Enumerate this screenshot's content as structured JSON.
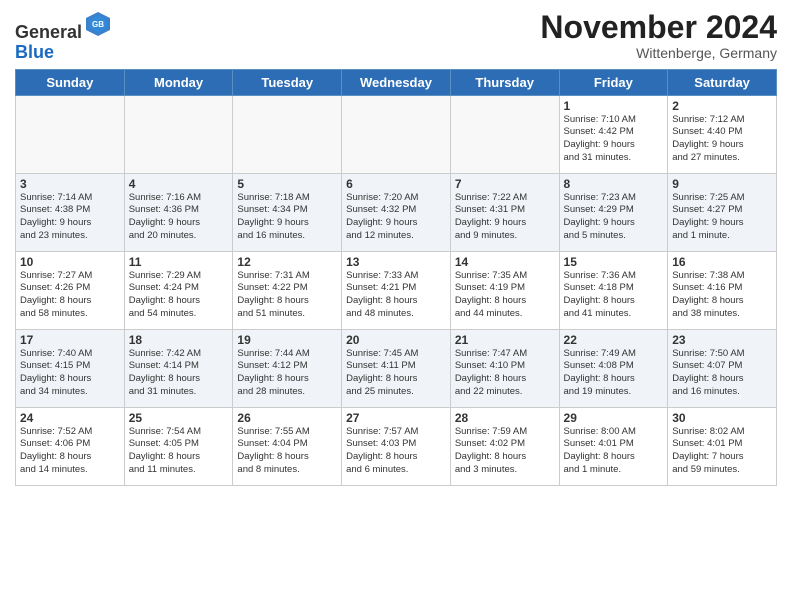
{
  "header": {
    "logo_line1": "General",
    "logo_line2": "Blue",
    "month": "November 2024",
    "location": "Wittenberge, Germany"
  },
  "weekdays": [
    "Sunday",
    "Monday",
    "Tuesday",
    "Wednesday",
    "Thursday",
    "Friday",
    "Saturday"
  ],
  "weeks": [
    [
      {
        "day": "",
        "info": ""
      },
      {
        "day": "",
        "info": ""
      },
      {
        "day": "",
        "info": ""
      },
      {
        "day": "",
        "info": ""
      },
      {
        "day": "",
        "info": ""
      },
      {
        "day": "1",
        "info": "Sunrise: 7:10 AM\nSunset: 4:42 PM\nDaylight: 9 hours\nand 31 minutes."
      },
      {
        "day": "2",
        "info": "Sunrise: 7:12 AM\nSunset: 4:40 PM\nDaylight: 9 hours\nand 27 minutes."
      }
    ],
    [
      {
        "day": "3",
        "info": "Sunrise: 7:14 AM\nSunset: 4:38 PM\nDaylight: 9 hours\nand 23 minutes."
      },
      {
        "day": "4",
        "info": "Sunrise: 7:16 AM\nSunset: 4:36 PM\nDaylight: 9 hours\nand 20 minutes."
      },
      {
        "day": "5",
        "info": "Sunrise: 7:18 AM\nSunset: 4:34 PM\nDaylight: 9 hours\nand 16 minutes."
      },
      {
        "day": "6",
        "info": "Sunrise: 7:20 AM\nSunset: 4:32 PM\nDaylight: 9 hours\nand 12 minutes."
      },
      {
        "day": "7",
        "info": "Sunrise: 7:22 AM\nSunset: 4:31 PM\nDaylight: 9 hours\nand 9 minutes."
      },
      {
        "day": "8",
        "info": "Sunrise: 7:23 AM\nSunset: 4:29 PM\nDaylight: 9 hours\nand 5 minutes."
      },
      {
        "day": "9",
        "info": "Sunrise: 7:25 AM\nSunset: 4:27 PM\nDaylight: 9 hours\nand 1 minute."
      }
    ],
    [
      {
        "day": "10",
        "info": "Sunrise: 7:27 AM\nSunset: 4:26 PM\nDaylight: 8 hours\nand 58 minutes."
      },
      {
        "day": "11",
        "info": "Sunrise: 7:29 AM\nSunset: 4:24 PM\nDaylight: 8 hours\nand 54 minutes."
      },
      {
        "day": "12",
        "info": "Sunrise: 7:31 AM\nSunset: 4:22 PM\nDaylight: 8 hours\nand 51 minutes."
      },
      {
        "day": "13",
        "info": "Sunrise: 7:33 AM\nSunset: 4:21 PM\nDaylight: 8 hours\nand 48 minutes."
      },
      {
        "day": "14",
        "info": "Sunrise: 7:35 AM\nSunset: 4:19 PM\nDaylight: 8 hours\nand 44 minutes."
      },
      {
        "day": "15",
        "info": "Sunrise: 7:36 AM\nSunset: 4:18 PM\nDaylight: 8 hours\nand 41 minutes."
      },
      {
        "day": "16",
        "info": "Sunrise: 7:38 AM\nSunset: 4:16 PM\nDaylight: 8 hours\nand 38 minutes."
      }
    ],
    [
      {
        "day": "17",
        "info": "Sunrise: 7:40 AM\nSunset: 4:15 PM\nDaylight: 8 hours\nand 34 minutes."
      },
      {
        "day": "18",
        "info": "Sunrise: 7:42 AM\nSunset: 4:14 PM\nDaylight: 8 hours\nand 31 minutes."
      },
      {
        "day": "19",
        "info": "Sunrise: 7:44 AM\nSunset: 4:12 PM\nDaylight: 8 hours\nand 28 minutes."
      },
      {
        "day": "20",
        "info": "Sunrise: 7:45 AM\nSunset: 4:11 PM\nDaylight: 8 hours\nand 25 minutes."
      },
      {
        "day": "21",
        "info": "Sunrise: 7:47 AM\nSunset: 4:10 PM\nDaylight: 8 hours\nand 22 minutes."
      },
      {
        "day": "22",
        "info": "Sunrise: 7:49 AM\nSunset: 4:08 PM\nDaylight: 8 hours\nand 19 minutes."
      },
      {
        "day": "23",
        "info": "Sunrise: 7:50 AM\nSunset: 4:07 PM\nDaylight: 8 hours\nand 16 minutes."
      }
    ],
    [
      {
        "day": "24",
        "info": "Sunrise: 7:52 AM\nSunset: 4:06 PM\nDaylight: 8 hours\nand 14 minutes."
      },
      {
        "day": "25",
        "info": "Sunrise: 7:54 AM\nSunset: 4:05 PM\nDaylight: 8 hours\nand 11 minutes."
      },
      {
        "day": "26",
        "info": "Sunrise: 7:55 AM\nSunset: 4:04 PM\nDaylight: 8 hours\nand 8 minutes."
      },
      {
        "day": "27",
        "info": "Sunrise: 7:57 AM\nSunset: 4:03 PM\nDaylight: 8 hours\nand 6 minutes."
      },
      {
        "day": "28",
        "info": "Sunrise: 7:59 AM\nSunset: 4:02 PM\nDaylight: 8 hours\nand 3 minutes."
      },
      {
        "day": "29",
        "info": "Sunrise: 8:00 AM\nSunset: 4:01 PM\nDaylight: 8 hours\nand 1 minute."
      },
      {
        "day": "30",
        "info": "Sunrise: 8:02 AM\nSunset: 4:01 PM\nDaylight: 7 hours\nand 59 minutes."
      }
    ]
  ]
}
